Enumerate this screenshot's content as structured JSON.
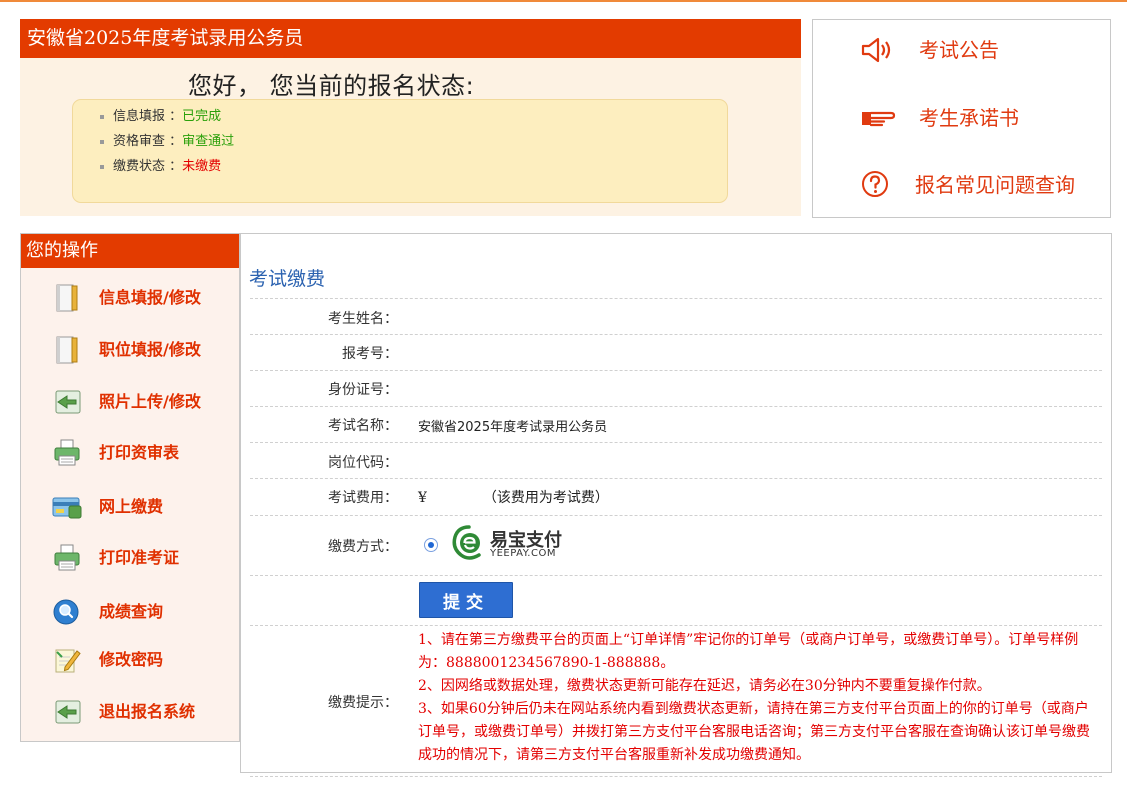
{
  "status_panel": {
    "header": "安徽省2025年度考试录用公务员",
    "greeting": "您好， 您当前的报名状态:",
    "items": [
      {
        "label": "信息填报 ：",
        "value": "已完成",
        "color": "#2aa00a"
      },
      {
        "label": "资格审查 ：",
        "value": "审查通过",
        "color": "#2aa00a"
      },
      {
        "label": "缴费状态 ：",
        "value": "未缴费",
        "color": "#e30000"
      }
    ]
  },
  "quick_links": {
    "announcement": "考试公告",
    "commitment": "考生承诺书",
    "faq": "报名常见问题查询"
  },
  "sidebar": {
    "title": "您的操作",
    "items": [
      {
        "label": "信息填报/修改",
        "icon": "notebook-icon"
      },
      {
        "label": "职位填报/修改",
        "icon": "notebook-icon"
      },
      {
        "label": "照片上传/修改",
        "icon": "photo-icon"
      },
      {
        "label": "打印资审表",
        "icon": "printer-icon"
      },
      {
        "label": "网上缴费",
        "icon": "card-icon"
      },
      {
        "label": "打印准考证",
        "icon": "printer-icon"
      },
      {
        "label": "成绩查询",
        "icon": "magnifier-icon"
      },
      {
        "label": "修改密码",
        "icon": "pencil-note-icon"
      },
      {
        "label": "退出报名系统",
        "icon": "exit-icon"
      }
    ]
  },
  "main": {
    "title": "考试缴费",
    "fields": {
      "name_label": "考生姓名：",
      "regno_label": "报考号：",
      "idno_label": "身份证号：",
      "exam_label": "考试名称：",
      "exam_value": "安徽省2025年度考试录用公务员",
      "post_label": "岗位代码：",
      "fee_label": "考试费用：",
      "fee_currency": "¥",
      "fee_note": "（该费用为考试费）",
      "method_label": "缴费方式：",
      "yeepay_cn": "易宝支付",
      "yeepay_en": "YEEPAY.COM",
      "submit": "提交",
      "tips_label": "缴费提示：",
      "tip1": "1、请在第三方缴费平台的页面上“订单详情”牢记你的订单号（或商户订单号，或缴费订单号）。订单号样例为：8888001234567890-1-888888。",
      "tip2": "2、因网络或数据处理，缴费状态更新可能存在延迟，请务必在30分钟内不要重复操作付款。",
      "tip3": "3、如果60分钟后仍未在网站系统内看到缴费状态更新，请持在第三方支付平台页面上的你的订单号（或商户订单号，或缴费订单号）并拨打第三方支付平台客服电话咨询；第三方支付平台客服在查询确认该订单号缴费成功的情况下，请第三方支付平台客服重新补发成功缴费通知。"
    }
  },
  "colors": {
    "brand_red": "#e33b00",
    "link_red": "#e03a10",
    "title_blue": "#2b62b0",
    "button_blue": "#2e6ed2"
  }
}
